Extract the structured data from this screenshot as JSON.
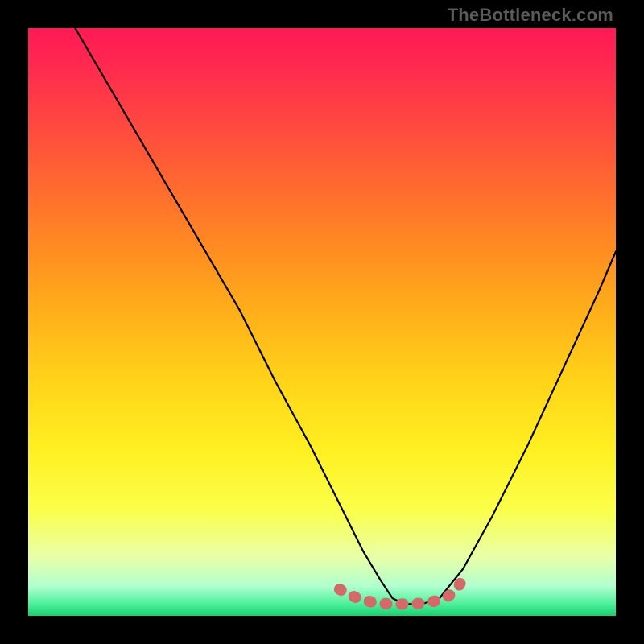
{
  "watermark": "TheBottleneck.com",
  "chart_data": {
    "type": "line",
    "title": "",
    "xlabel": "",
    "ylabel": "",
    "xlim": [
      0,
      100
    ],
    "ylim": [
      0,
      100
    ],
    "grid": false,
    "legend": false,
    "series": [
      {
        "name": "curve",
        "color": "#000000",
        "x": [
          8,
          15,
          22,
          29,
          36,
          42,
          48,
          53,
          57,
          60,
          62,
          64,
          67,
          70,
          74,
          79,
          85,
          91,
          97,
          100
        ],
        "y": [
          100,
          88,
          76,
          64,
          52,
          40,
          29,
          19,
          11,
          6,
          3,
          2,
          2,
          3,
          8,
          17,
          29,
          42,
          55,
          62
        ]
      },
      {
        "name": "highlight",
        "color": "#d36a6a",
        "x": [
          53,
          56,
          59,
          62,
          65,
          68,
          71,
          73,
          74
        ],
        "y": [
          4.5,
          3.0,
          2.2,
          2.0,
          2.0,
          2.2,
          3.0,
          4.5,
          6.5
        ]
      }
    ],
    "background_gradient": {
      "direction": "vertical",
      "stops": [
        {
          "pos": 0.0,
          "color": "#ff1a55"
        },
        {
          "pos": 0.16,
          "color": "#ff4740"
        },
        {
          "pos": 0.37,
          "color": "#ff8a22"
        },
        {
          "pos": 0.6,
          "color": "#ffd319"
        },
        {
          "pos": 0.82,
          "color": "#fbff4a"
        },
        {
          "pos": 0.95,
          "color": "#b0ffcf"
        },
        {
          "pos": 1.0,
          "color": "#18cf6e"
        }
      ]
    }
  }
}
